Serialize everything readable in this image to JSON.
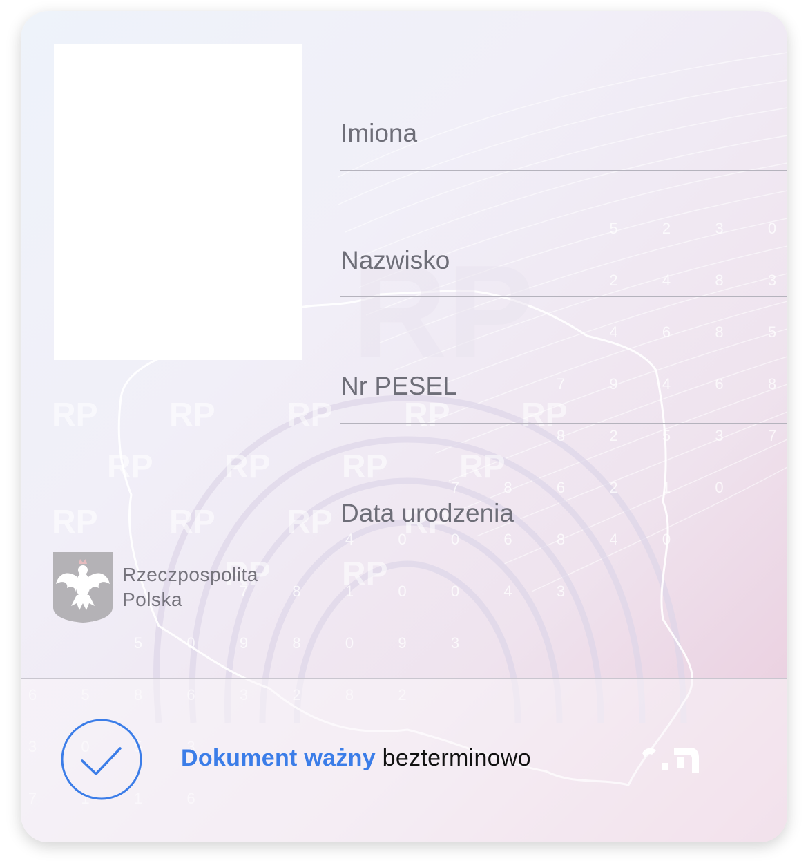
{
  "document": {
    "fields": [
      {
        "label": "Imiona"
      },
      {
        "label": "Nazwisko"
      },
      {
        "label": "Nr PESEL"
      },
      {
        "label": "Data urodzenia"
      }
    ],
    "issuer_line1": "Rzeczpospolita",
    "issuer_line2": "Polska",
    "status_valid": "Dokument ważny",
    "status_term": "bezterminowo"
  },
  "watermark": {
    "text": "RP",
    "digit_rows": [
      [
        "5",
        "2",
        "3",
        "0"
      ],
      [
        "2",
        "4",
        "8",
        "3"
      ],
      [
        "4",
        "6",
        "8",
        "5"
      ],
      [
        "7",
        "9",
        "4",
        "6",
        "8"
      ],
      [
        "8",
        "2",
        "5",
        "3",
        "7"
      ],
      [
        "7",
        "8",
        "6",
        "2",
        "1",
        "0"
      ],
      [
        "4",
        "0",
        "0",
        "6",
        "8",
        "4",
        "0"
      ],
      [
        "7",
        "8",
        "1",
        "0",
        "0",
        "4",
        "3"
      ],
      [
        "5",
        "0",
        "9",
        "8",
        "0",
        "9",
        "3"
      ],
      [
        "6",
        "5",
        "8",
        "6",
        "3",
        "2",
        "8",
        "2"
      ],
      [
        "3",
        "0",
        "5",
        "3"
      ],
      [
        "7",
        "1",
        "1",
        "6"
      ]
    ]
  },
  "colors": {
    "accent": "#3b7de8",
    "label": "#6e6e78",
    "divider": "#b5b3bd"
  },
  "icons": [
    "polish-eagle-emblem-icon",
    "check-circle-icon",
    "app-logo-icon"
  ]
}
